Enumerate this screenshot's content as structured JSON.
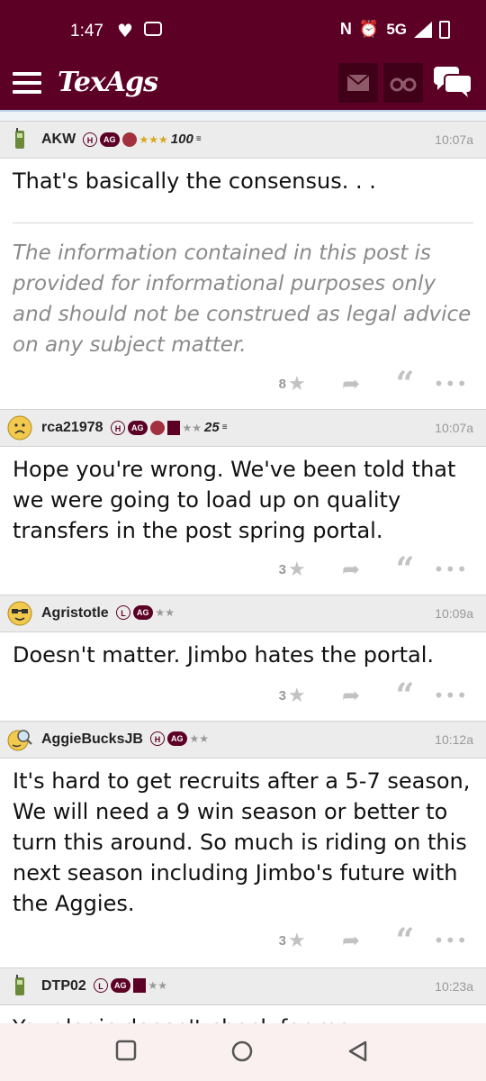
{
  "status_bar": {
    "time": "1:47",
    "network": "5G",
    "icons": [
      "heart-icon",
      "cast-icon",
      "nfc-icon",
      "alarm-icon",
      "signal-icon",
      "battery-icon"
    ]
  },
  "app_bar": {
    "logo": "TexAgs",
    "icons": [
      "menu-icon",
      "mail-icon",
      "binoculars-icon",
      "chat-icon"
    ]
  },
  "posts": [
    {
      "username": "AKW",
      "time": "10:07a",
      "avatar": "phone-icon",
      "badges": [
        "H",
        "AG"
      ],
      "stars": "★★★",
      "star_color": "#d8a818",
      "count": "100",
      "body": "That's basically the consensus. . .",
      "signature": "The information contained in this post is provided for informational purposes only and should not be construed as legal advice on any subject matter.",
      "likes": "8"
    },
    {
      "username": "rca21978",
      "time": "10:07a",
      "avatar": "frown-face-icon",
      "badges": [
        "H",
        "AG"
      ],
      "stars": "★★",
      "count": "25",
      "body": "Hope you're wrong. We've been told that we were going to load up on quality transfers in the post spring portal.",
      "likes": "3"
    },
    {
      "username": "Agristotle",
      "time": "10:09a",
      "avatar": "nerd-face-icon",
      "badges": [
        "L",
        "AG"
      ],
      "stars": "★★",
      "body": "Doesn't matter. Jimbo hates the portal.",
      "likes": "3"
    },
    {
      "username": "AggieBucksJB",
      "time": "10:12a",
      "avatar": "magnifier-face-icon",
      "badges": [
        "H",
        "AG"
      ],
      "stars": "★★",
      "body": "It's hard to get recruits after a 5-7 season, We will need a 9 win season or better to turn this around. So much is riding on this next season including Jimbo's future with the Aggies.",
      "likes": "3"
    },
    {
      "username": "DTP02",
      "time": "10:23a",
      "avatar": "phone-icon",
      "badges": [
        "L",
        "AG"
      ],
      "stars": "★★",
      "body": "Your logic doesn't check for me"
    }
  ],
  "colors": {
    "maroon": "#5c0025",
    "gold": "#d8a818"
  },
  "nav_bar": {
    "icons": [
      "recent-apps-icon",
      "home-icon",
      "back-icon"
    ]
  }
}
